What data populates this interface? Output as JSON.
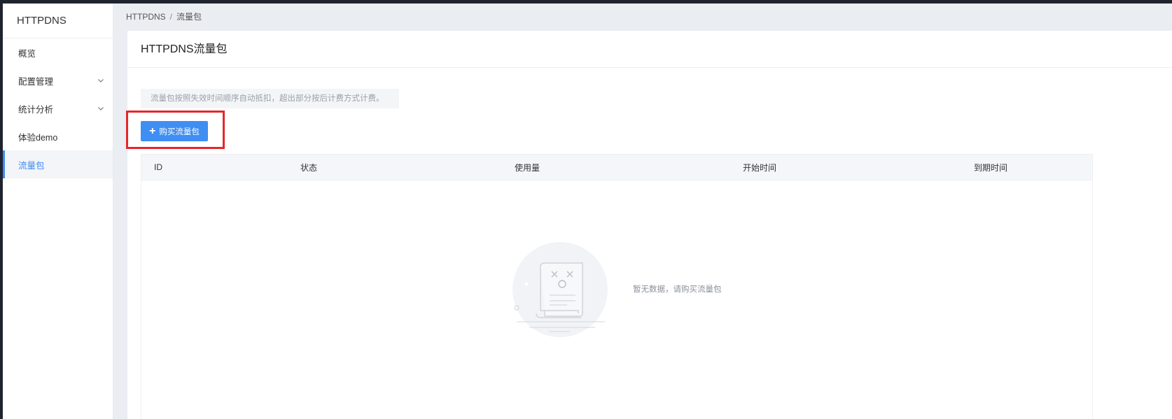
{
  "sidebar": {
    "brand": "HTTPDNS",
    "items": [
      {
        "label": "概览",
        "has_children": false,
        "active": false
      },
      {
        "label": "配置管理",
        "has_children": true,
        "active": false
      },
      {
        "label": "统计分析",
        "has_children": true,
        "active": false
      },
      {
        "label": "体验demo",
        "has_children": false,
        "active": false
      },
      {
        "label": "流量包",
        "has_children": false,
        "active": true
      }
    ]
  },
  "breadcrumb": {
    "root": "HTTPDNS",
    "separator": "/",
    "current": "流量包"
  },
  "panel": {
    "title": "HTTPDNS流量包",
    "notice": "流量包按照失效时间顺序自动抵扣，超出部分按后计费方式计费。",
    "buy_button": {
      "label": "购买流量包",
      "icon": "plus-icon"
    }
  },
  "table": {
    "columns": [
      "ID",
      "状态",
      "使用量",
      "开始时间",
      "到期时间"
    ],
    "rows": [],
    "empty_text": "暂无数据，请购买流量包",
    "empty_icon": "empty-document-icon"
  },
  "colors": {
    "accent": "#3f8ef3",
    "highlight": "#e6262b",
    "background": "#eaedf1"
  }
}
